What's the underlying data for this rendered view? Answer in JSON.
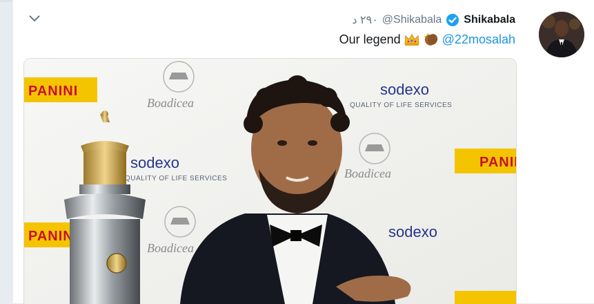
{
  "tweet": {
    "author_name": "Shikabala",
    "author_handle": "@Shikabala",
    "timestamp": "٢٩٠ د",
    "text": "Our legend",
    "mention": "@22mosalah",
    "emojis": [
      "crown-emoji",
      "clapping-hands-emoji"
    ],
    "verified": true
  },
  "media": {
    "sponsor_logos": {
      "panini": "PANINI",
      "sodexo": "sodexo",
      "sodexo_tagline": "QUALITY OF LIFE SERVICES",
      "boadicea": "Boadicea"
    }
  },
  "colors": {
    "link": "#1b95e0",
    "verified": "#1da1f2",
    "text": "#14171a",
    "secondary": "#657786"
  }
}
